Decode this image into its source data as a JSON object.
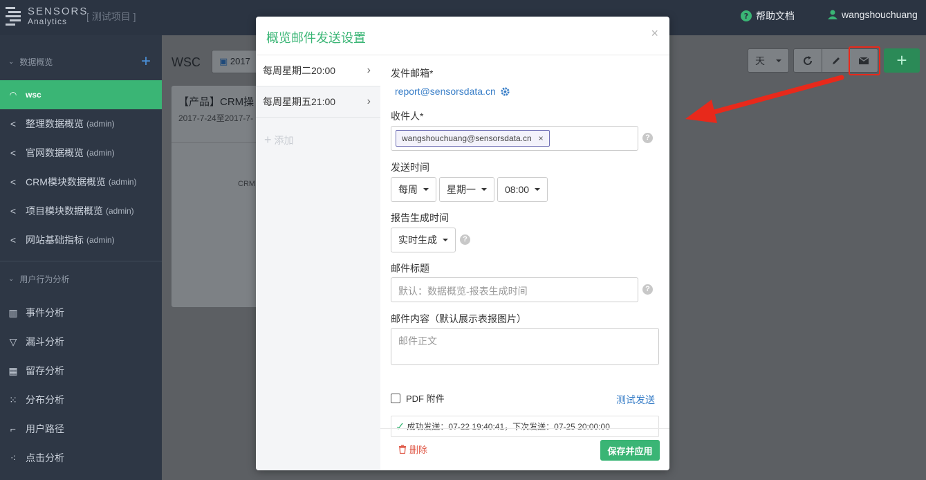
{
  "topbar": {
    "logo_line1": "SENSORS",
    "logo_line2": "Analytics",
    "project": "[ 测试项目 ]",
    "help": "帮助文档",
    "user": "wangshouchuang"
  },
  "sidebar": {
    "section1": "数据概览",
    "section2": "用户行为分析",
    "items": [
      {
        "label": "wsc",
        "suffix": ""
      },
      {
        "label": "整理数据概览",
        "suffix": "(admin)"
      },
      {
        "label": "官网数据概览",
        "suffix": "(admin)"
      },
      {
        "label": "CRM模块数据概览",
        "suffix": "(admin)"
      },
      {
        "label": "项目模块数据概览",
        "suffix": "(admin)"
      },
      {
        "label": "网站基础指标",
        "suffix": "(admin)"
      }
    ],
    "analysis": [
      {
        "label": "事件分析"
      },
      {
        "label": "漏斗分析"
      },
      {
        "label": "留存分析"
      },
      {
        "label": "分布分析"
      },
      {
        "label": "用户路径"
      },
      {
        "label": "点击分析"
      }
    ]
  },
  "main": {
    "title": "WSC",
    "date": "2017",
    "card_title": "【产品】CRM操",
    "card_range": "2017-7-24至2017-7-",
    "card_label": "CRM",
    "granularity": "天"
  },
  "modal": {
    "title": "概览邮件发送设置",
    "close": "×",
    "schedules": [
      "每周星期二20:00",
      "每周星期五21:00"
    ],
    "add": "添加",
    "sender_label": "发件邮箱*",
    "sender_email": "report@sensorsdata.cn",
    "recipient_label": "收件人*",
    "recipient_tag": "wangshouchuang@sensorsdata.cn",
    "send_time_label": "发送时间",
    "frequency": "每周",
    "weekday": "星期一",
    "time": "08:00",
    "gen_label": "报告生成时间",
    "gen_value": "实时生成",
    "subject_label": "邮件标题",
    "subject_placeholder": "默认：数据概览-报表生成时间",
    "content_label": "邮件内容（默认展示表报图片）",
    "content_placeholder": "邮件正文",
    "pdf_label": "PDF 附件",
    "test_send": "测试发送",
    "status": "成功发送：07-22 19:40:41，下次发送：07-25 20:00:00",
    "delete": "删除",
    "save": "保存并应用"
  },
  "colors": {
    "accent_green": "#3ab575",
    "link_blue": "#3a7fc8",
    "highlight_red": "#e8291b"
  }
}
